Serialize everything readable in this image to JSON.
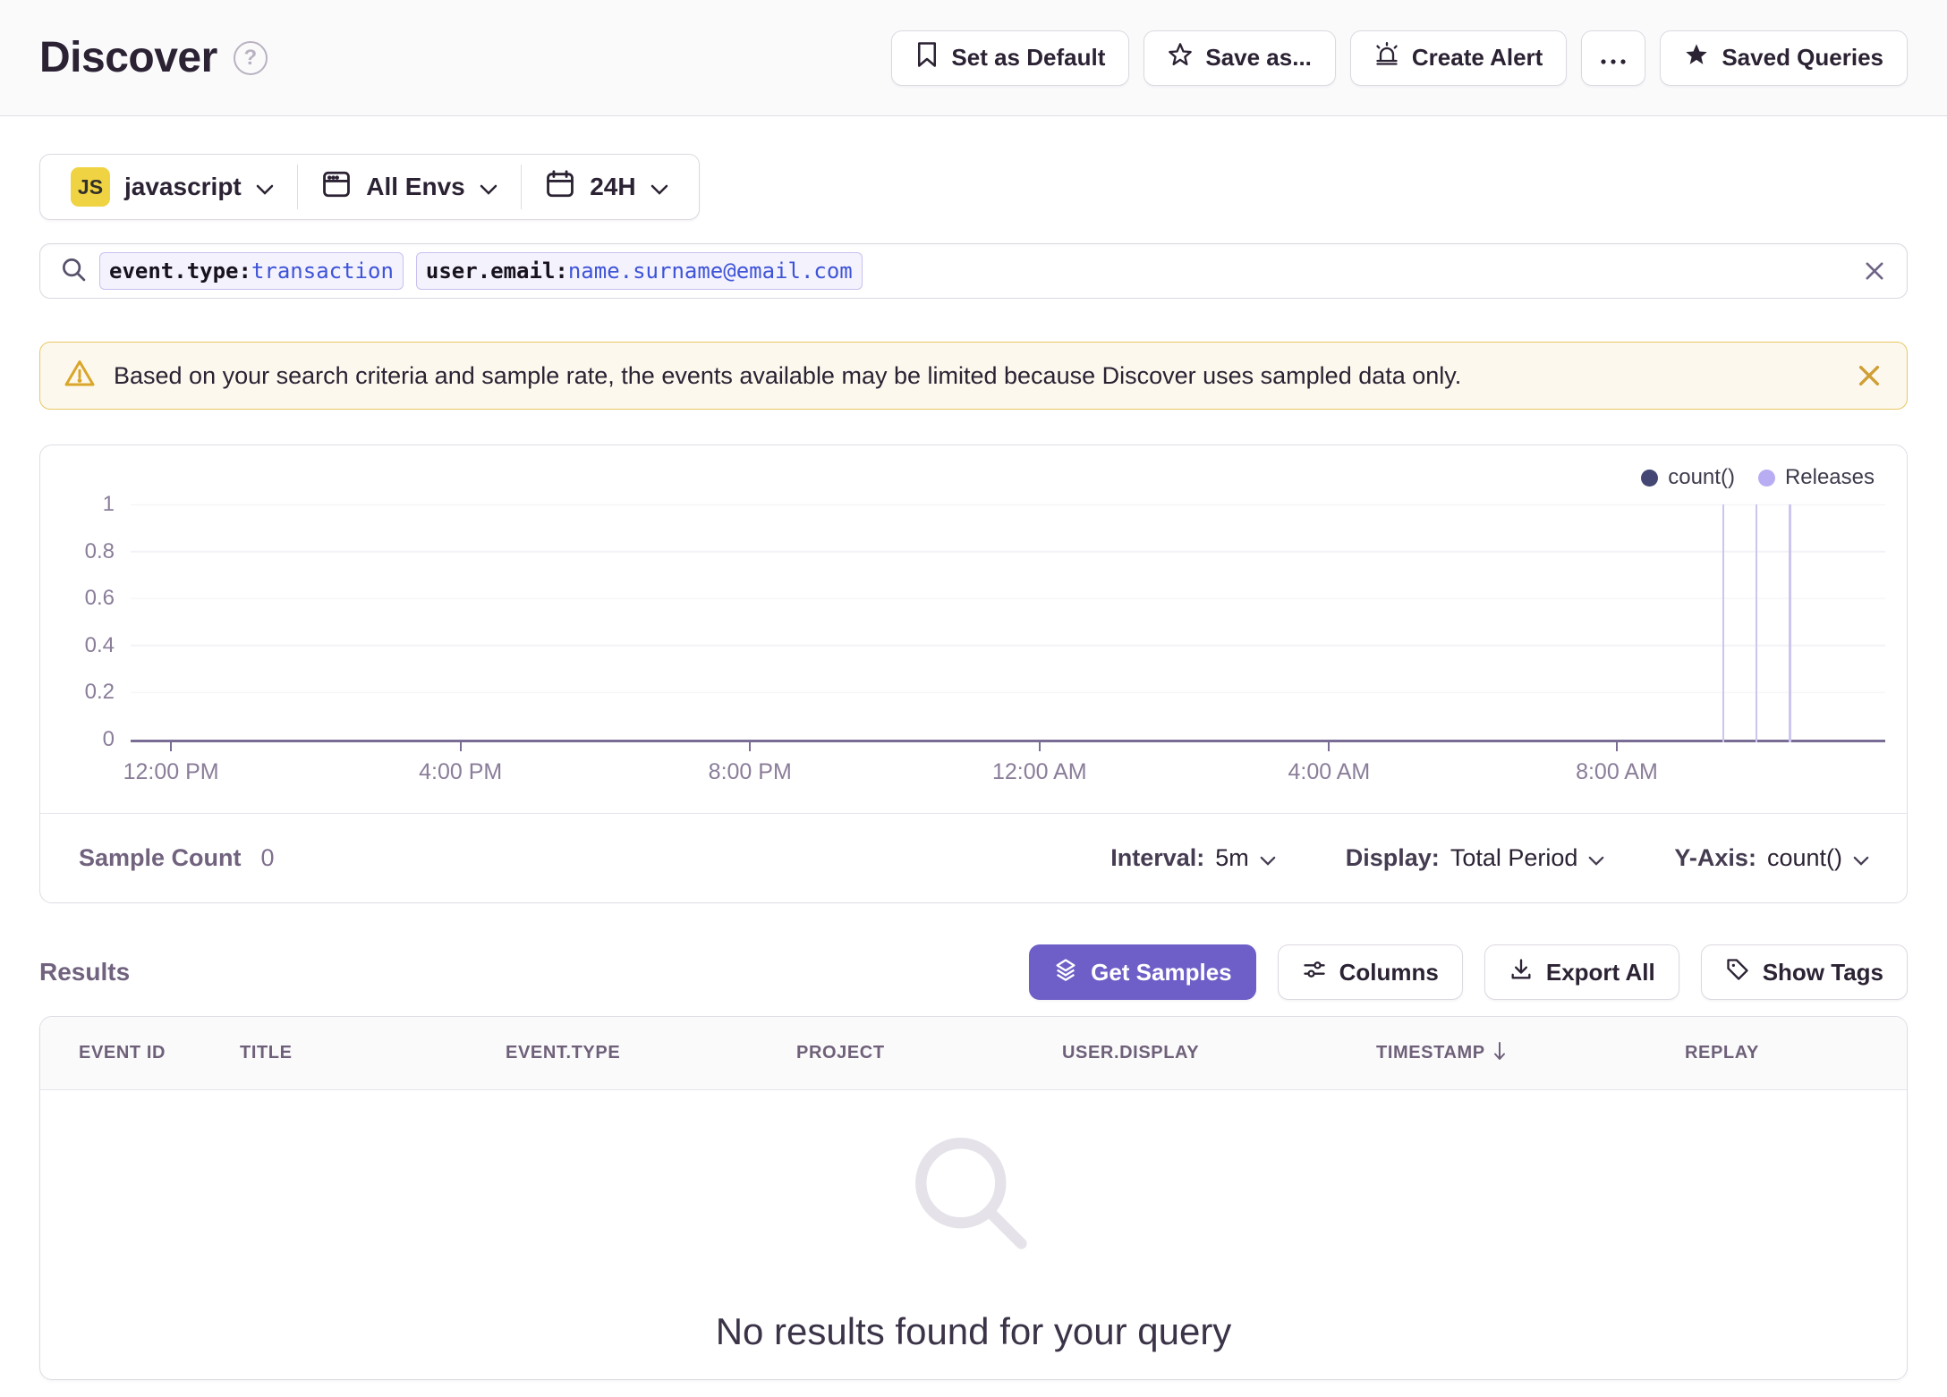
{
  "header": {
    "title": "Discover",
    "actions": [
      {
        "label": "Set as Default",
        "icon": "bookmark-icon"
      },
      {
        "label": "Save as...",
        "icon": "star-outline-icon"
      },
      {
        "label": "Create Alert",
        "icon": "siren-icon"
      },
      {
        "label": "",
        "icon": "ellipsis-icon"
      },
      {
        "label": "Saved Queries",
        "icon": "star-filled-icon"
      }
    ]
  },
  "filters": {
    "project": {
      "badge": "JS",
      "label": "javascript",
      "icon": "js-platform-badge"
    },
    "environment": {
      "label": "All Envs",
      "icon": "window-icon"
    },
    "time_range": {
      "label": "24H",
      "icon": "calendar-icon"
    }
  },
  "search": {
    "tokens": [
      {
        "key": "event.type:",
        "value": "transaction"
      },
      {
        "key": "user.email:",
        "value": "name.surname@email.com"
      }
    ]
  },
  "alert": {
    "message": "Based on your search criteria and sample rate, the events available may be limited because Discover uses sampled data only."
  },
  "chart_data": {
    "type": "line",
    "title": "",
    "xlabel": "",
    "ylabel": "",
    "ylim": [
      0,
      1
    ],
    "grid": true,
    "legend_position": "top-right",
    "y_ticks": [
      "0",
      "0.2",
      "0.4",
      "0.6",
      "0.8",
      "1"
    ],
    "x_ticks": [
      "12:00 PM",
      "4:00 PM",
      "8:00 PM",
      "12:00 AM",
      "4:00 AM",
      "8:00 AM"
    ],
    "x_tick_positions_pct": [
      2.3,
      18.8,
      35.3,
      51.8,
      68.3,
      84.7
    ],
    "series": [
      {
        "name": "count()",
        "color": "#444674",
        "values": []
      }
    ],
    "releases": {
      "name": "Releases",
      "dot_color": "#b8adf2",
      "line_color": "#ccc5ee",
      "positions_pct": [
        90.7,
        92.6,
        94.5
      ]
    }
  },
  "chart_footer": {
    "sample_count_label": "Sample Count",
    "sample_count_value": "0",
    "interval_label": "Interval:",
    "interval_value": "5m",
    "display_label": "Display:",
    "display_value": "Total Period",
    "yaxis_label": "Y-Axis:",
    "yaxis_value": "count()"
  },
  "results": {
    "heading": "Results",
    "buttons": [
      {
        "label": "Get Samples",
        "icon": "stack-icon",
        "primary": true
      },
      {
        "label": "Columns",
        "icon": "sliders-icon",
        "primary": false
      },
      {
        "label": "Export All",
        "icon": "download-icon",
        "primary": false
      },
      {
        "label": "Show Tags",
        "icon": "tag-icon",
        "primary": false
      }
    ],
    "table": {
      "columns": [
        "EVENT ID",
        "TITLE",
        "EVENT.TYPE",
        "PROJECT",
        "USER.DISPLAY",
        "TIMESTAMP",
        "REPLAY"
      ],
      "sorted_by": "TIMESTAMP",
      "sort_direction": "desc",
      "rows": [],
      "empty_message": "No results found for your query"
    }
  },
  "colors": {
    "accent_purple": "#6d5fc7",
    "warning_bg": "#fdf8ed",
    "warning_border": "#e7c763",
    "warning_icon": "#d9a629",
    "token_value_blue": "#3e54d8",
    "js_badge_yellow": "#f0d343"
  }
}
